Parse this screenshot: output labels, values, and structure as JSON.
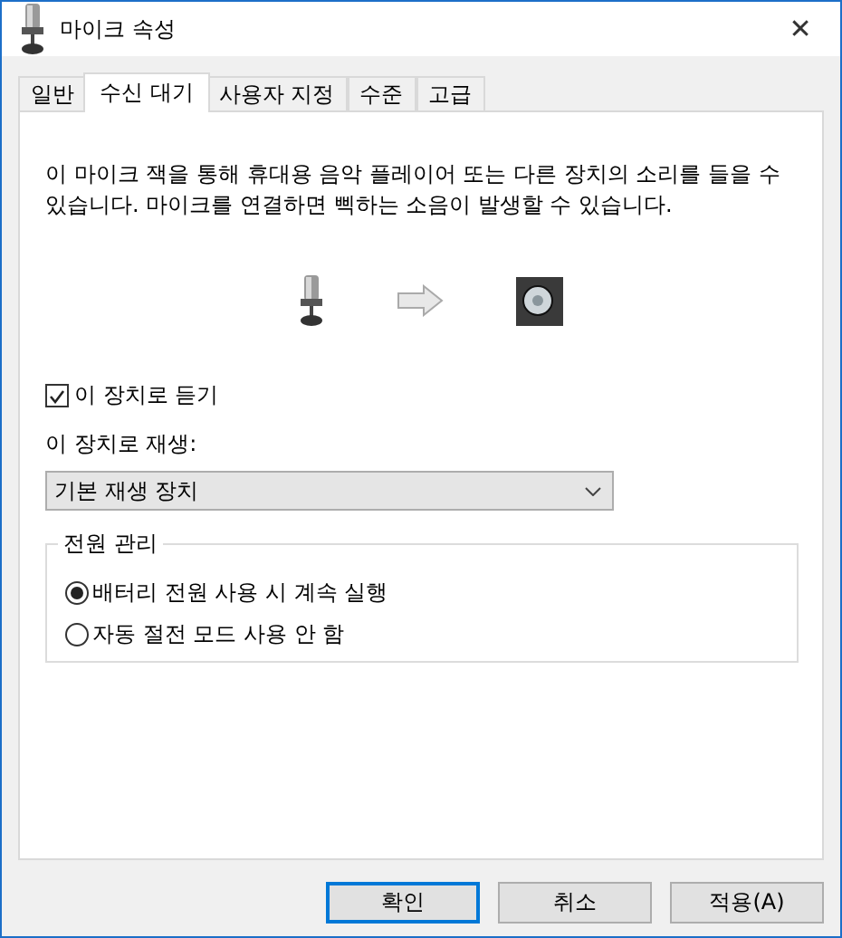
{
  "window": {
    "title": "마이크 속성",
    "close": "✕"
  },
  "tabs": [
    {
      "label": "일반",
      "selected": false
    },
    {
      "label": "수신 대기",
      "selected": true
    },
    {
      "label": "사용자 지정",
      "selected": false
    },
    {
      "label": "수준",
      "selected": false
    },
    {
      "label": "고급",
      "selected": false
    }
  ],
  "description": "이 마이크 잭을 통해 휴대용 음악 플레이어 또는 다른 장치의 소리를 들을 수 있습니다. 마이크를 연결하면 삑하는 소음이 발생할 수 있습니다.",
  "listen": {
    "label": "이 장치로 듣기",
    "checked": true
  },
  "playback": {
    "label": "이 장치로 재생:",
    "value": "기본 재생 장치"
  },
  "power": {
    "title": "전원 관리",
    "options": [
      {
        "label": "배터리 전원 사용 시 계속 실행",
        "selected": true
      },
      {
        "label": "자동 절전 모드 사용 안 함",
        "selected": false
      }
    ]
  },
  "buttons": [
    {
      "label": "확인",
      "default": true
    },
    {
      "label": "취소",
      "default": false
    },
    {
      "label": "적용(A)",
      "default": false
    }
  ]
}
